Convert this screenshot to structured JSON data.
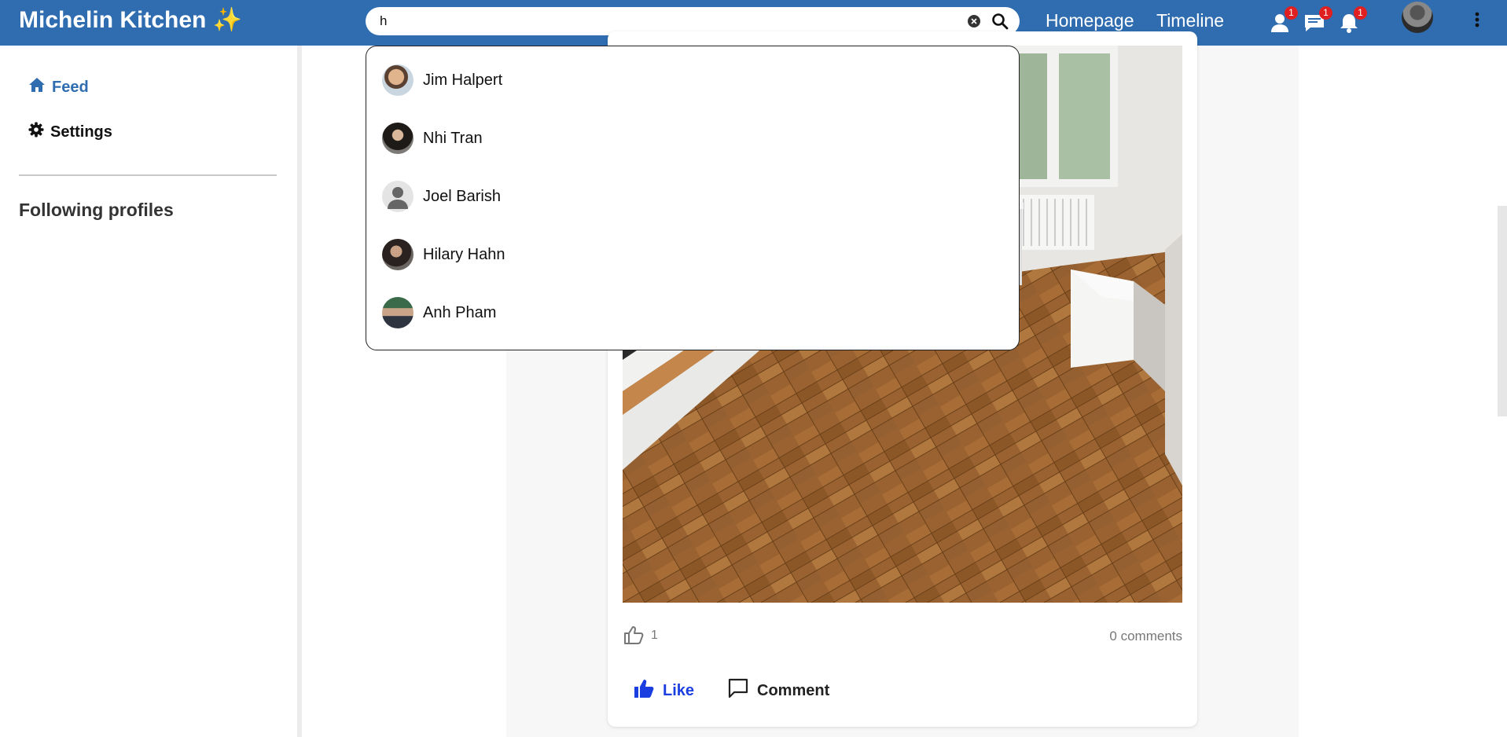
{
  "header": {
    "brand": "Michelin Kitchen",
    "brand_emoji": "✨",
    "search_value": "h",
    "nav": [
      "Homepage",
      "Timeline"
    ],
    "badges": {
      "friends": "1",
      "messages": "1",
      "notifications": "1"
    }
  },
  "sidebar": {
    "items": [
      {
        "label": "Feed",
        "icon": "home-icon",
        "active": true
      },
      {
        "label": "Settings",
        "icon": "gear-icon",
        "active": false
      }
    ],
    "following_title": "Following profiles"
  },
  "search_results": [
    {
      "name": "Jim Halpert"
    },
    {
      "name": "Nhi Tran"
    },
    {
      "name": "Joel Barish"
    },
    {
      "name": "Hilary Hahn"
    },
    {
      "name": "Anh Pham"
    }
  ],
  "post": {
    "like_count": "1",
    "comments_text": "0 comments",
    "like_label": "Like",
    "comment_label": "Comment"
  },
  "colors": {
    "brand_blue": "#2f6db0",
    "badge_red": "#e02020",
    "like_blue": "#1a3ee0"
  }
}
